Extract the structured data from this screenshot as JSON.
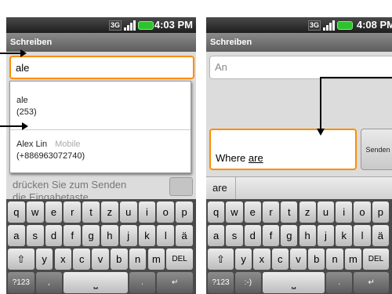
{
  "left_screen": {
    "status": {
      "network": "3G",
      "time": "4:03 PM"
    },
    "title": "Schreiben",
    "to_value": "ale",
    "suggestions": [
      {
        "name": "ale",
        "number": "(253)"
      },
      {
        "name": "Alex Lin",
        "type": "Mobile",
        "number": "(+886963072740)"
      }
    ],
    "hint_lines": [
      "drücken Sie zum Senden",
      "die Eingabetaste."
    ]
  },
  "right_screen": {
    "status": {
      "network": "3G",
      "time": "4:08 PM"
    },
    "title": "Schreiben",
    "to_placeholder": "An",
    "body_text_prefix": "Where ",
    "body_text_word": "are",
    "send_label": "Senden",
    "suggestion": "are"
  },
  "keyboard_left": {
    "row1": [
      "q",
      "w",
      "e",
      "r",
      "t",
      "z",
      "u",
      "i",
      "o",
      "p"
    ],
    "row2": [
      "a",
      "s",
      "d",
      "f",
      "g",
      "h",
      "j",
      "k",
      "l",
      "ä"
    ],
    "row3": [
      "⇧",
      "y",
      "x",
      "c",
      "v",
      "b",
      "n",
      "m",
      "DEL"
    ],
    "row4": [
      "?123",
      ",",
      "␣",
      ".",
      "↵"
    ]
  },
  "keyboard_right": {
    "row1": [
      "q",
      "w",
      "e",
      "r",
      "t",
      "z",
      "u",
      "i",
      "o",
      "p"
    ],
    "row2": [
      "a",
      "s",
      "d",
      "f",
      "g",
      "h",
      "j",
      "k",
      "l",
      "ä"
    ],
    "row3": [
      "⇧",
      "y",
      "x",
      "c",
      "v",
      "b",
      "n",
      "m",
      "DEL"
    ],
    "row4": [
      "?123",
      ":-)",
      "␣",
      ".",
      "↵"
    ]
  },
  "colors": {
    "focus_orange": "#ff8d00",
    "battery_green": "#2ec22e"
  }
}
